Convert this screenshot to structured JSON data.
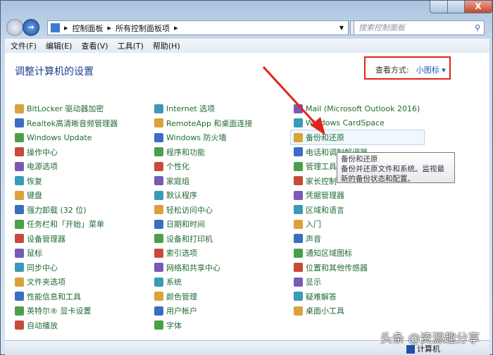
{
  "window": {
    "minimize": "minimize",
    "maximize": "maximize",
    "close": "X"
  },
  "address": {
    "crumbs": [
      "控制面板",
      "所有控制面板项"
    ],
    "search_placeholder": "搜索控制面板"
  },
  "menu": [
    "文件(F)",
    "编辑(E)",
    "查看(V)",
    "工具(T)",
    "帮助(H)"
  ],
  "page": {
    "title": "调整计算机的设置",
    "view_by_label": "查看方式:",
    "view_by_value": "小图标 ▾"
  },
  "columns": [
    [
      "BitLocker 驱动器加密",
      "Realtek高清晰音频管理器",
      "Windows Update",
      "操作中心",
      "电源选项",
      "恢复",
      "键盘",
      "强力卸载 (32 位)",
      "任务栏和「开始」菜单",
      "设备管理器",
      "鼠标",
      "同步中心",
      "文件夹选项",
      "性能信息和工具",
      "英特尔® 显卡设置",
      "自动播放"
    ],
    [
      "Internet 选项",
      "RemoteApp 和桌面连接",
      "Windows 防火墙",
      "程序和功能",
      "个性化",
      "家庭组",
      "默认程序",
      "轻松访问中心",
      "日期和时间",
      "设备和打印机",
      "索引选项",
      "网络和共享中心",
      "系统",
      "颜色管理",
      "用户帐户",
      "字体"
    ],
    [
      "Mail (Microsoft Outlook 2016)",
      "Windows CardSpace",
      "备份和还原",
      "电话和调制解调器",
      "管理工具",
      "家长控制",
      "凭据管理器",
      "区域和语言",
      "入门",
      "声音",
      "通知区域图标",
      "位置和其他传感器",
      "显示",
      "疑难解答",
      "桌面小工具"
    ]
  ],
  "tooltip": {
    "title": "备份和还原",
    "body": "备份并还原文件和系统。监视最新的备份状态和配置。"
  },
  "status": {
    "computer": "计算机"
  },
  "watermark": "头条 @资源趣分享",
  "colors": {
    "link": "#1f6b34",
    "highlight": "#e2231a"
  }
}
